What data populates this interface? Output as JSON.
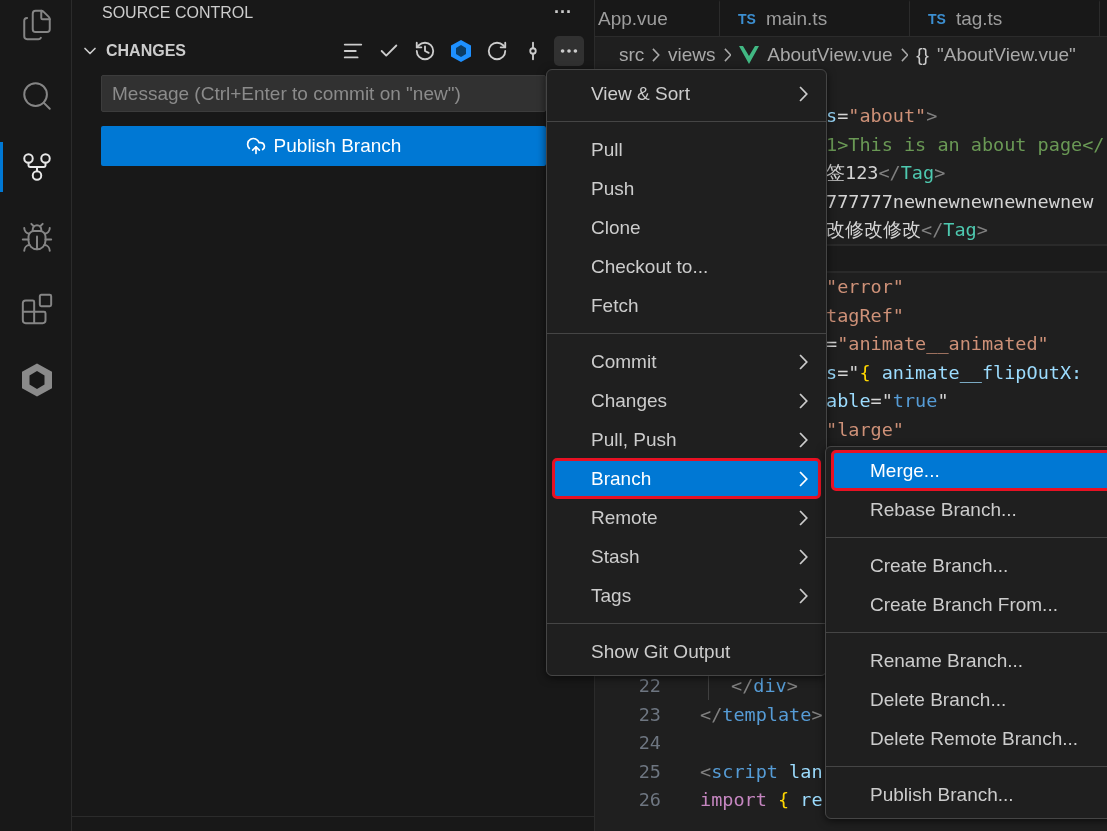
{
  "activity_bar": {
    "items": [
      {
        "kind": "files",
        "selected": false
      },
      {
        "kind": "search",
        "selected": false
      },
      {
        "kind": "source_control",
        "selected": true
      },
      {
        "kind": "run",
        "selected": false
      },
      {
        "kind": "extensions",
        "selected": false
      },
      {
        "kind": "cube",
        "selected": false
      }
    ]
  },
  "sidebar": {
    "title": "SOURCE CONTROL",
    "more": "···",
    "section": {
      "title": "CHANGES",
      "expanded": true,
      "actions": [
        {
          "kind": "lines"
        },
        {
          "kind": "check"
        },
        {
          "kind": "history"
        },
        {
          "kind": "cube"
        },
        {
          "kind": "refresh"
        },
        {
          "kind": "graph"
        },
        {
          "kind": "more"
        }
      ],
      "message": {
        "placeholder": "Message (Ctrl+Enter to commit on \"new\")"
      },
      "publish_button": "Publish Branch"
    }
  },
  "editor": {
    "tabs": [
      {
        "label": "App.vue",
        "selected": false
      },
      {
        "label": "main.ts",
        "badge": "TS",
        "selected": false
      },
      {
        "label": "tag.ts",
        "badge": "TS",
        "selected": false
      }
    ],
    "breadcrumb": [
      {
        "label": "src",
        "kind": "folder"
      },
      {
        "label": "views",
        "kind": "folder"
      },
      {
        "label": "AboutView.vue",
        "kind": "vue"
      },
      {
        "label": "\"AboutView.vue\"",
        "kind": "object",
        "icon": "{}"
      }
    ],
    "lines": [
      {
        "kind": "hidden"
      },
      {
        "kind": "covered",
        "tokens": [
          {
            "t": "s",
            "kind": "attr"
          },
          {
            "t": "=",
            "kind": "text"
          },
          {
            "t": "\"about\"",
            "kind": "string"
          },
          {
            "t": ">",
            "kind": "punct"
          }
        ]
      },
      {
        "kind": "covered",
        "tokens": [
          {
            "t": "1>This is an about page</",
            "kind": "comment"
          }
        ]
      },
      {
        "kind": "covered",
        "tokens": [
          {
            "t": "签123",
            "kind": "text"
          },
          {
            "t": "</",
            "kind": "punct"
          },
          {
            "t": "Tag",
            "kind": "component"
          },
          {
            "t": ">",
            "kind": "punct"
          }
        ]
      },
      {
        "kind": "covered",
        "tokens": [
          {
            "t": "777777newnewnewnewnewnew",
            "kind": "text"
          }
        ]
      },
      {
        "kind": "covered",
        "tokens": [
          {
            "t": "改修改修改",
            "kind": "text"
          },
          {
            "t": "</",
            "kind": "punct"
          },
          {
            "t": "Tag",
            "kind": "component"
          },
          {
            "t": ">",
            "kind": "punct"
          }
        ]
      },
      {
        "kind": "sticky"
      },
      {
        "kind": "covered",
        "tokens": [
          {
            "t": "\"error\"",
            "kind": "string"
          }
        ]
      },
      {
        "kind": "covered",
        "tokens": [
          {
            "t": "tagRef\"",
            "kind": "string"
          }
        ]
      },
      {
        "kind": "covered",
        "tokens": [
          {
            "t": "=",
            "kind": "text"
          },
          {
            "t": "\"animate__animated\"",
            "kind": "string"
          }
        ]
      },
      {
        "kind": "covered",
        "tokens": [
          {
            "t": "s",
            "kind": "attr"
          },
          {
            "t": "=\"",
            "kind": "text"
          },
          {
            "t": "{",
            "kind": "bracket"
          },
          {
            "t": " animate__flipOutX:",
            "kind": "attr"
          }
        ]
      },
      {
        "kind": "covered",
        "tokens": [
          {
            "t": "able",
            "kind": "attr"
          },
          {
            "t": "=\"",
            "kind": "text"
          },
          {
            "t": "true",
            "kind": "keyword"
          },
          {
            "t": "\"",
            "kind": "text"
          }
        ]
      },
      {
        "kind": "covered",
        "tokens": [
          {
            "t": "\"large\"",
            "kind": "string"
          }
        ]
      },
      {
        "kind": "hidden"
      },
      {
        "kind": "hidden"
      },
      {
        "kind": "hidden"
      },
      {
        "kind": "hidden"
      },
      {
        "kind": "hidden"
      },
      {
        "kind": "hidden"
      },
      {
        "kind": "hidden"
      },
      {
        "kind": "hidden"
      },
      {
        "kind": "full",
        "number": "22",
        "indented": true,
        "tokens": [
          {
            "t": "</",
            "kind": "punct"
          },
          {
            "t": "div",
            "kind": "tag"
          },
          {
            "t": ">",
            "kind": "punct"
          }
        ]
      },
      {
        "kind": "full",
        "number": "23",
        "tokens": [
          {
            "t": "</",
            "kind": "punct"
          },
          {
            "t": "template",
            "kind": "tag"
          },
          {
            "t": ">",
            "kind": "punct"
          }
        ]
      },
      {
        "kind": "full",
        "number": "24"
      },
      {
        "kind": "full",
        "number": "25",
        "tokens": [
          {
            "t": "<",
            "kind": "punct"
          },
          {
            "t": "script",
            "kind": "tag"
          },
          {
            "t": " lan",
            "kind": "attr"
          }
        ]
      },
      {
        "kind": "full",
        "number": "26",
        "tokens": [
          {
            "t": "import",
            "kind": "import"
          },
          {
            "t": " {",
            "kind": "bracket"
          },
          {
            "t": " re",
            "kind": "attr"
          }
        ]
      }
    ]
  },
  "context_menu": {
    "groups": [
      [
        {
          "label": "View & Sort",
          "kind": "submenu",
          "selected": false,
          "outlined": false
        }
      ],
      [
        {
          "label": "Pull",
          "kind": "item",
          "selected": false,
          "outlined": false
        },
        {
          "label": "Push",
          "kind": "item",
          "selected": false,
          "outlined": false
        },
        {
          "label": "Clone",
          "kind": "item",
          "selected": false,
          "outlined": false
        },
        {
          "label": "Checkout to...",
          "kind": "item",
          "selected": false,
          "outlined": false
        },
        {
          "label": "Fetch",
          "kind": "item",
          "selected": false,
          "outlined": false
        }
      ],
      [
        {
          "label": "Commit",
          "kind": "submenu",
          "selected": false,
          "outlined": false
        },
        {
          "label": "Changes",
          "kind": "submenu",
          "selected": false,
          "outlined": false
        },
        {
          "label": "Pull, Push",
          "kind": "submenu",
          "selected": false,
          "outlined": false
        },
        {
          "label": "Branch",
          "kind": "submenu",
          "selected": true,
          "outlined": true
        },
        {
          "label": "Remote",
          "kind": "submenu",
          "selected": false,
          "outlined": false
        },
        {
          "label": "Stash",
          "kind": "submenu",
          "selected": false,
          "outlined": false
        },
        {
          "label": "Tags",
          "kind": "submenu",
          "selected": false,
          "outlined": false
        }
      ],
      [
        {
          "label": "Show Git Output",
          "kind": "item",
          "selected": false,
          "outlined": false
        }
      ]
    ]
  },
  "submenu": {
    "groups": [
      [
        {
          "label": "Merge...",
          "kind": "item",
          "selected": true,
          "outlined": true
        },
        {
          "label": "Rebase Branch...",
          "kind": "item",
          "selected": false,
          "outlined": false
        }
      ],
      [
        {
          "label": "Create Branch...",
          "kind": "item",
          "selected": false,
          "outlined": false
        },
        {
          "label": "Create Branch From...",
          "kind": "item",
          "selected": false,
          "outlined": false
        }
      ],
      [
        {
          "label": "Rename Branch...",
          "kind": "item",
          "selected": false,
          "outlined": false
        },
        {
          "label": "Delete Branch...",
          "kind": "item",
          "selected": false,
          "outlined": false
        },
        {
          "label": "Delete Remote Branch...",
          "kind": "item",
          "selected": false,
          "outlined": false
        }
      ],
      [
        {
          "label": "Publish Branch...",
          "kind": "item",
          "selected": false,
          "outlined": false
        }
      ]
    ]
  }
}
